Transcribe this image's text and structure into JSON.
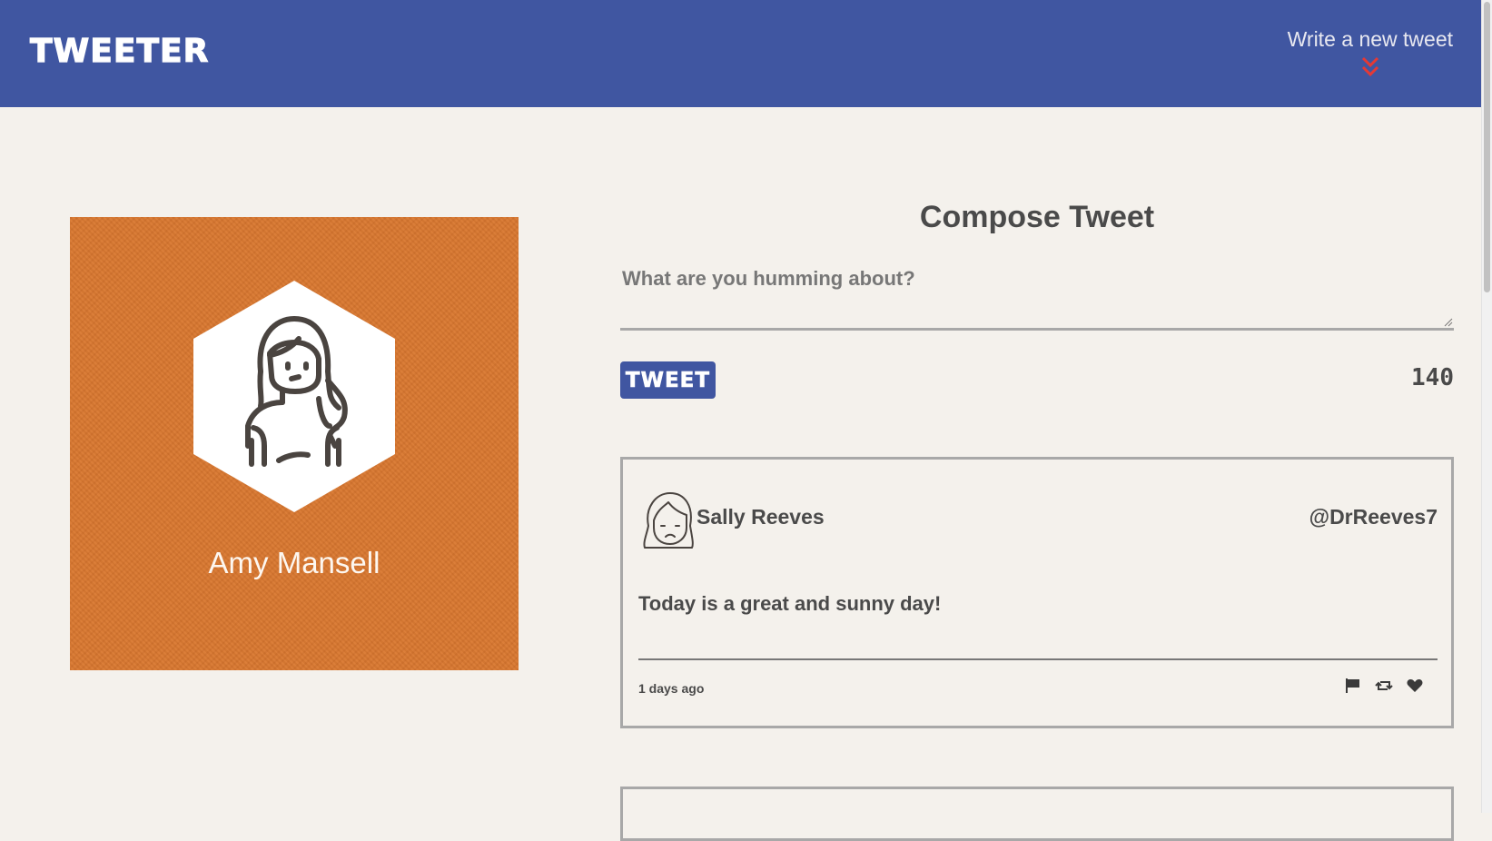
{
  "nav": {
    "brand": "TWEETER",
    "compose_label": "Write a new tweet",
    "arrow_icon": "double-chevron-down-icon",
    "arrow_color": "#e53935",
    "background": "#4056a1"
  },
  "profile": {
    "name": "Amy Mansell",
    "avatar_icon": "woman-avatar-icon",
    "background": "#d9772f"
  },
  "compose": {
    "title": "Compose Tweet",
    "placeholder": "What are you humming about?",
    "value": "",
    "button_label": "TWEET",
    "counter": "140"
  },
  "tweets": [
    {
      "name": "Sally Reeves",
      "handle": "@DrReeves7",
      "avatar_icon": "woman-face-avatar-icon",
      "text": "Today is a great and sunny day!",
      "time": "1 days ago",
      "actions": [
        "flag-icon",
        "retweet-icon",
        "heart-icon"
      ]
    }
  ]
}
